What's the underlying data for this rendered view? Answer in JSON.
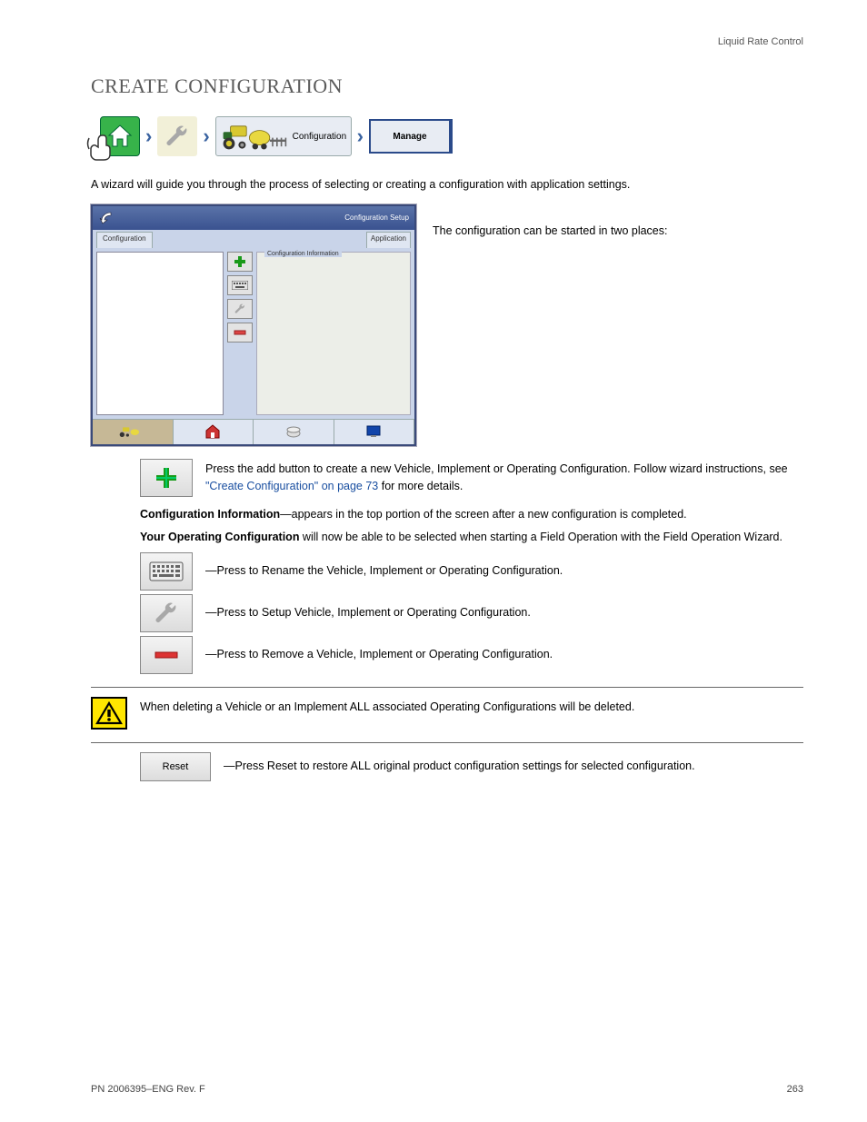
{
  "header": {
    "category": "Liquid Rate Control"
  },
  "title": "CREATE CONFIGURATION",
  "breadcrumb": {
    "config_label": "Configuration",
    "manage_label": "Manage"
  },
  "intro": "A wizard will guide you through the process of selecting or creating a configuration with application settings.",
  "device": {
    "tab_left": "Configuration",
    "tab_right": "Application",
    "info_title": "Configuration Information"
  },
  "side": "The configuration can be started in two places:",
  "add_row": {
    "desc_prefix": "Press the add button to create a new Vehicle, Implement or Operating Configuration. Follow wizard instructions, see ",
    "desc_link": "\"Create Configuration\" on page 73",
    "desc_suffix": " for more details."
  },
  "config_info": {
    "row1_head": "Configuration Information",
    "row1_body": "—appears in the top portion of the screen after a new configuration is completed.",
    "row2_head": "Your Operating Configuration",
    "row2_body": " will now be able to be selected when starting a Field Operation with the Field Operation Wizard.",
    "keyboard": "—Press to Rename the Vehicle, Implement or Operating Configuration.",
    "wrench": "—Press to Setup Vehicle, Implement or Operating Configuration.",
    "minus": "—Press to Remove a Vehicle, Implement or Operating Configuration."
  },
  "caution": "When deleting a Vehicle or an Implement ALL associated Operating Configurations will be deleted.",
  "reset_btn": "Reset",
  "reset_desc": "—Press Reset to restore ALL original product configuration settings for selected configuration.",
  "footer": {
    "rev": "PN 2006395–ENG Rev. F",
    "page": "263"
  }
}
